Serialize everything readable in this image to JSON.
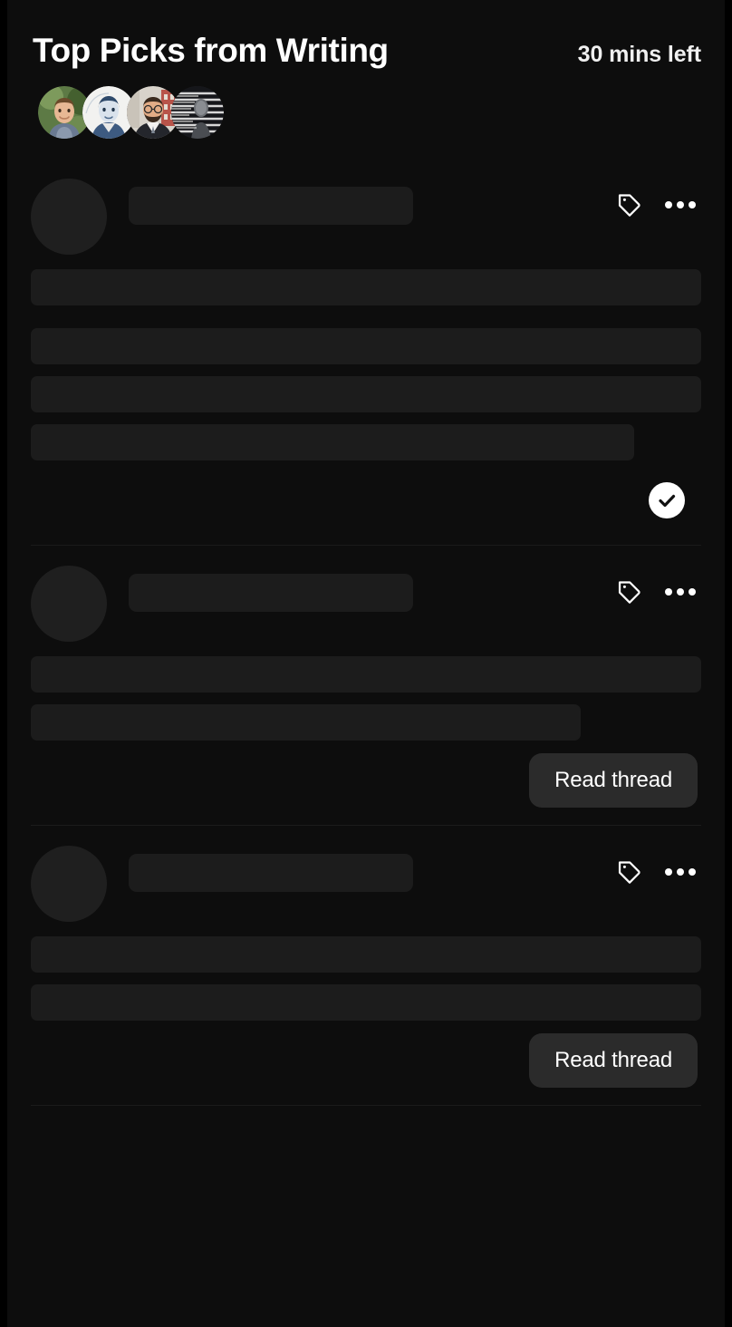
{
  "header": {
    "title": "Top Picks from Writing",
    "time_left": "30 mins left",
    "avatars": [
      {
        "name": "avatar-person-1",
        "alt": "Smiling man outdoors"
      },
      {
        "name": "avatar-person-2",
        "alt": "Illustrated portrait of a man"
      },
      {
        "name": "avatar-person-3",
        "alt": "Man with glasses and beard in suit"
      },
      {
        "name": "avatar-person-4",
        "alt": "Black and white motion portrait"
      }
    ]
  },
  "colors": {
    "page_background": "#0d0d0d",
    "outer_background": "#000000",
    "skeleton": "#1c1c1c",
    "skeleton_avatar": "#1f1f1f",
    "divider": "#1b1b1b",
    "button_background": "#2b2b2b",
    "text_primary": "#ffffff",
    "badge_background": "#ffffff"
  },
  "icons": {
    "tag": "tag-icon",
    "more": "more-horizontal-icon",
    "check": "check-circle-icon"
  },
  "cards": [
    {
      "id": "thread-card-1",
      "loading": true,
      "tag_icon_label": "tag-icon",
      "more_icon_label": "more-horizontal-icon",
      "skeleton_lines": [
        "100%",
        "100%",
        "100%",
        "90%"
      ],
      "status": "completed",
      "status_icon": "check-circle-icon",
      "action_label": null
    },
    {
      "id": "thread-card-2",
      "loading": true,
      "tag_icon_label": "tag-icon",
      "more_icon_label": "more-horizontal-icon",
      "skeleton_lines": [
        "100%",
        "82%"
      ],
      "status": null,
      "status_icon": null,
      "action_label": "Read thread"
    },
    {
      "id": "thread-card-3",
      "loading": true,
      "tag_icon_label": "tag-icon",
      "more_icon_label": "more-horizontal-icon",
      "skeleton_lines": [
        "100%",
        "100%"
      ],
      "status": null,
      "status_icon": null,
      "action_label": "Read thread"
    }
  ]
}
